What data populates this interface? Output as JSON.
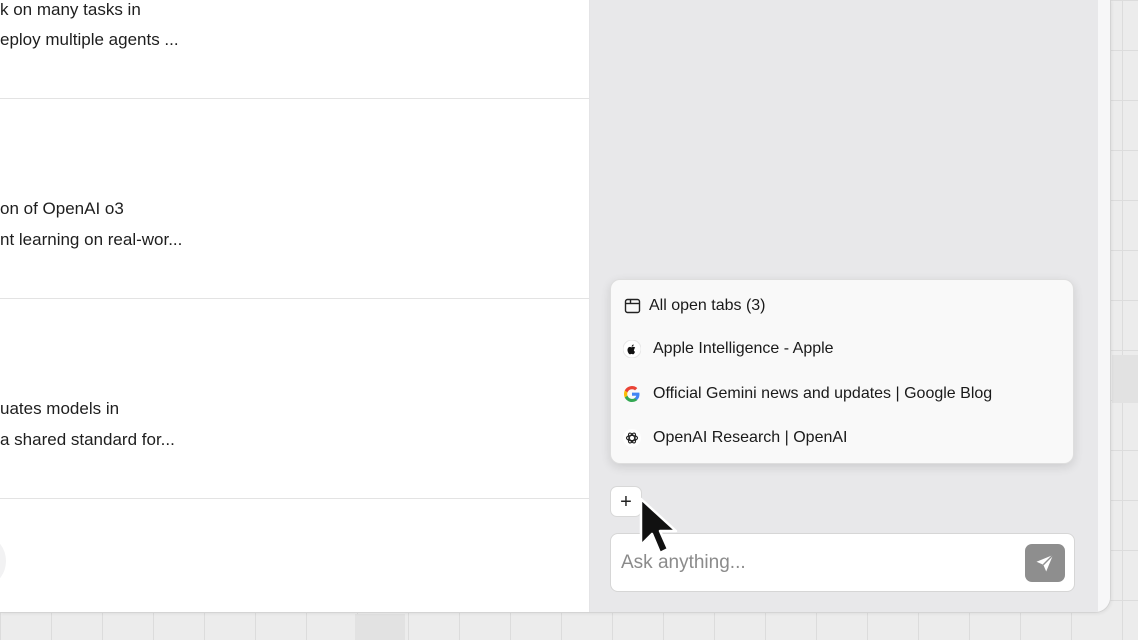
{
  "articles": [
    {
      "line1": "k on many tasks in",
      "line2": "eploy multiple agents ..."
    },
    {
      "line1": "on of OpenAI o3",
      "line2": "nt learning on real-wor..."
    },
    {
      "line1": "uates models in",
      "line2": "a shared standard for..."
    }
  ],
  "tabs_menu": {
    "header": "All open tabs (3)",
    "items": [
      {
        "label": "Apple Intelligence - Apple",
        "icon": "apple-icon"
      },
      {
        "label": "Official Gemini news and updates | Google Blog",
        "icon": "google-icon"
      },
      {
        "label": "OpenAI Research | OpenAI",
        "icon": "openai-icon"
      }
    ]
  },
  "composer": {
    "placeholder": "Ask anything...",
    "add_label": "+"
  },
  "colors": {
    "send_button": "#8e8e8e",
    "sidebar_bg": "#e8e8ea"
  }
}
